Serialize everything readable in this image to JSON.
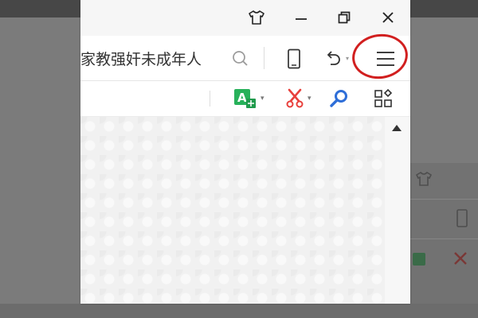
{
  "toolbar": {
    "search_value": "家教强奸未成年人"
  },
  "colors": {
    "highlight": "#d11f1f",
    "addon_green": "#27b15a",
    "addon_red": "#e8403c",
    "addon_blue": "#2e6ed8"
  },
  "icons": {
    "titlebar": [
      "skin-icon",
      "minimize-icon",
      "restore-icon",
      "close-icon"
    ],
    "toolbar": [
      "search-icon",
      "mobile-icon",
      "undo-icon",
      "menu-icon"
    ],
    "addons": [
      "translate-icon",
      "screenshot-icon",
      "magnifier-icon",
      "apps-icon"
    ]
  }
}
